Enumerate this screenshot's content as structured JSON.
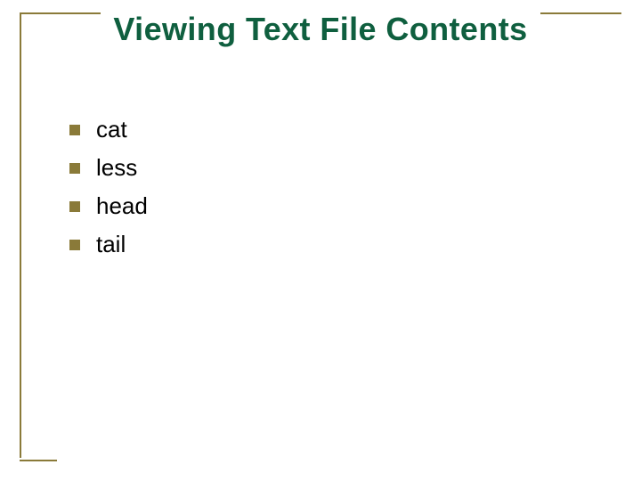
{
  "slide": {
    "title": "Viewing Text File Contents",
    "items": [
      {
        "label": "cat"
      },
      {
        "label": "less"
      },
      {
        "label": "head"
      },
      {
        "label": "tail"
      }
    ]
  },
  "colors": {
    "accent": "#8a7a39",
    "title": "#0f5f3f"
  }
}
